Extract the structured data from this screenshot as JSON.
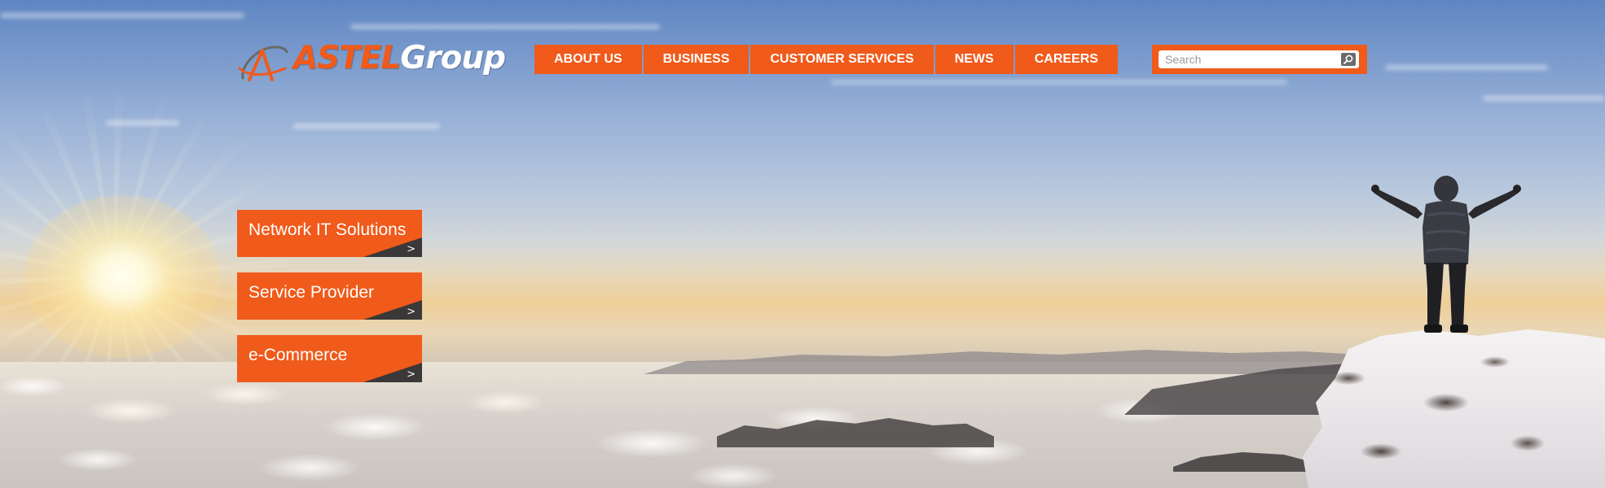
{
  "header": {
    "logo": {
      "brand": "ASTEL",
      "group": "Group",
      "icon": "astel-swoosh-icon"
    },
    "nav": {
      "items": [
        {
          "label": "ABOUT US"
        },
        {
          "label": "BUSINESS"
        },
        {
          "label": "CUSTOMER SERVICES"
        },
        {
          "label": "NEWS"
        },
        {
          "label": "CAREERS"
        }
      ]
    },
    "search": {
      "placeholder": "Search",
      "value": "",
      "icon": "search-icon"
    }
  },
  "tiles": [
    {
      "label": "Network IT Solutions",
      "arrow": ">"
    },
    {
      "label": "Service Provider",
      "arrow": ">"
    },
    {
      "label": "e-Commerce",
      "arrow": ">"
    }
  ],
  "colors": {
    "accent": "#f05a1a",
    "corner": "#3a3838",
    "logo_group": "#ffffff"
  }
}
